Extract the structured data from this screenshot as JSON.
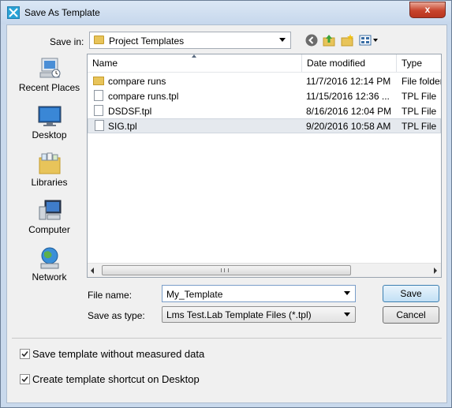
{
  "window": {
    "title": "Save As Template",
    "close_label": "x"
  },
  "toolbar": {
    "save_in_label": "Save in:",
    "save_in_value": "Project Templates"
  },
  "places": [
    {
      "label": "Recent Places",
      "icon": "recent-places-icon"
    },
    {
      "label": "Desktop",
      "icon": "desktop-icon"
    },
    {
      "label": "Libraries",
      "icon": "libraries-icon"
    },
    {
      "label": "Computer",
      "icon": "computer-icon"
    },
    {
      "label": "Network",
      "icon": "network-icon"
    }
  ],
  "file_list": {
    "columns": [
      "Name",
      "Date modified",
      "Type"
    ],
    "rows": [
      {
        "name": "compare runs",
        "date": "11/7/2016 12:14 PM",
        "type": "File folder",
        "icon": "folder-icon"
      },
      {
        "name": "compare runs.tpl",
        "date": "11/15/2016 12:36 ...",
        "type": "TPL File",
        "icon": "file-icon"
      },
      {
        "name": "DSDSF.tpl",
        "date": "8/16/2016 12:04 PM",
        "type": "TPL File",
        "icon": "file-icon"
      },
      {
        "name": "SIG.tpl",
        "date": "9/20/2016 10:58 AM",
        "type": "TPL File",
        "icon": "file-icon",
        "selected": true
      }
    ]
  },
  "form": {
    "file_name_label": "File name:",
    "file_name_value": "My_Template",
    "save_as_type_label": "Save as type:",
    "save_as_type_value": "Lms Test.Lab Template Files (*.tpl)"
  },
  "buttons": {
    "save": "Save",
    "cancel": "Cancel"
  },
  "options": [
    {
      "label": "Save template without measured data",
      "checked": true
    },
    {
      "label": "Create template shortcut on Desktop",
      "checked": true
    }
  ]
}
